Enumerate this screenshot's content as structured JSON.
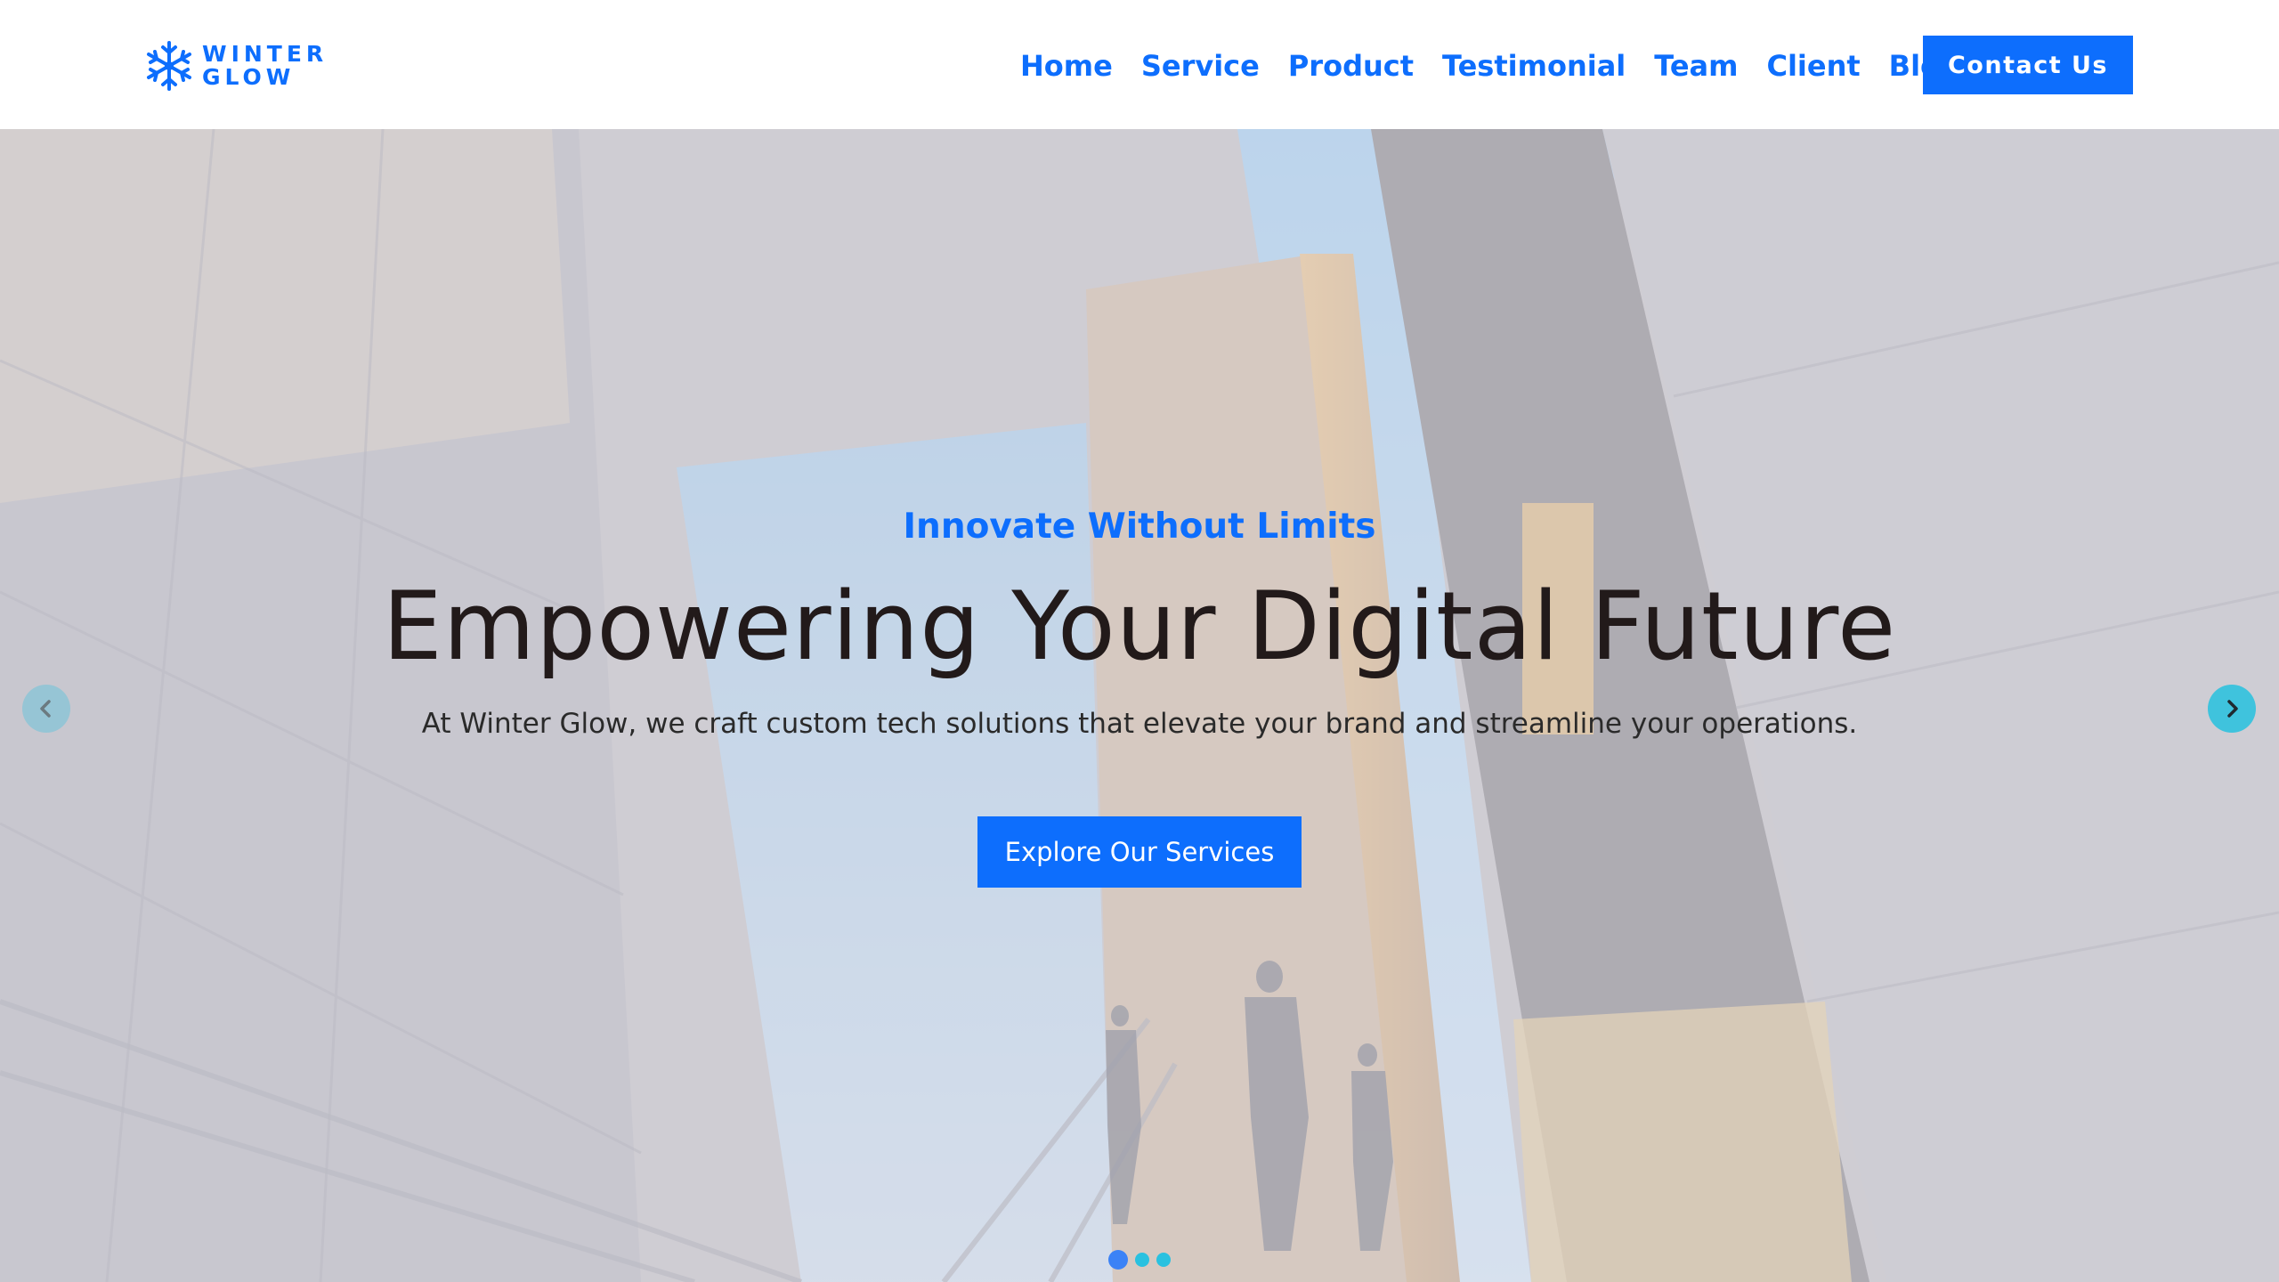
{
  "brand": {
    "name_line1": "WINTER",
    "name_line2": "GLOW",
    "logo_icon": "snowflake-icon"
  },
  "nav": {
    "items": [
      {
        "label": "Home"
      },
      {
        "label": "Service"
      },
      {
        "label": "Product"
      },
      {
        "label": "Testimonial"
      },
      {
        "label": "Team"
      },
      {
        "label": "Client"
      },
      {
        "label": "Blog"
      }
    ],
    "contact_label": "Contact Us"
  },
  "hero": {
    "eyebrow": "Innovate Without Limits",
    "title": "Empowering Your Digital Future",
    "subtitle": "At Winter Glow, we craft custom tech solutions that elevate your brand and streamline your operations.",
    "cta_label": "Explore Our Services",
    "background": "building-staircase-photo"
  },
  "carousel": {
    "prev_icon": "chevron-left-icon",
    "next_icon": "chevron-right-icon",
    "slide_count": 3,
    "active_slide": 1
  },
  "colors": {
    "accent": "#0d6efd",
    "title_text": "#221a1a",
    "arrow": "#3fc3dd",
    "dot": "#29c1e0",
    "dot_active": "#3b82f6"
  }
}
